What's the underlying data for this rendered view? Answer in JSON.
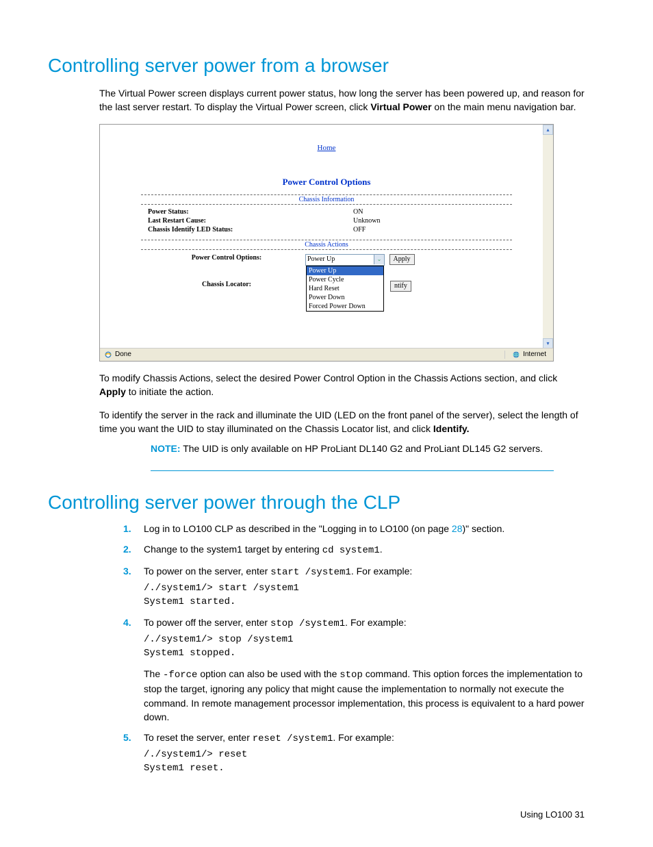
{
  "h1_browser": "Controlling server power from a browser",
  "intro_para_pre": "The Virtual Power screen displays current power status, how long the server has been powered up, and reason for the last server restart. To display the Virtual Power screen, click ",
  "intro_bold": "Virtual Power",
  "intro_para_post": " on the main menu navigation bar.",
  "screenshot": {
    "home_link": "Home",
    "title": "Power Control Options",
    "info_header": "Chassis Information",
    "rows": [
      {
        "label": "Power Status:",
        "value": "ON"
      },
      {
        "label": "Last Restart Cause:",
        "value": "Unknown"
      },
      {
        "label": "Chassis Identify LED Status:",
        "value": "OFF"
      }
    ],
    "actions_header": "Chassis Actions",
    "pco_label": "Power Control Options:",
    "pco_selected": "Power Up",
    "pco_options": [
      "Power Up",
      "Power Cycle",
      "Hard Reset",
      "Power Down",
      "Forced Power Down"
    ],
    "apply_btn": "Apply",
    "locator_label": "Chassis Locator:",
    "locator_btn": "ntify",
    "status_done": "Done",
    "status_zone": "Internet"
  },
  "modify_para_pre": "To modify Chassis Actions, select the desired Power Control Option in the Chassis Actions section, and click ",
  "modify_bold": "Apply",
  "modify_para_post": " to initiate the action.",
  "identify_para_pre": "To identify the server in the rack and illuminate the UID (LED on the front panel of the server), select the length of time you want the UID to stay illuminated on the Chassis Locator list, and click ",
  "identify_bold": "Identify.",
  "note_label": "NOTE:",
  "note_text": "  The UID is only available on HP ProLiant DL140 G2 and ProLiant DL145 G2 servers.",
  "h1_clp": "Controlling server power through the CLP",
  "steps": {
    "s1_pre": "Log in to LO100 CLP as described in the \"Logging in to LO100 (on page ",
    "s1_link": "28",
    "s1_post": ")\" section.",
    "s2_pre": "Change to the system1 target by entering ",
    "s2_code": "cd system1",
    "s2_post": ".",
    "s3_pre": "To power on the server, enter ",
    "s3_code": "start /system1",
    "s3_post": ". For example:",
    "s3_block": "/./system1/> start /system1\nSystem1 started.",
    "s4_pre": "To power off the server, enter ",
    "s4_code": "stop /system1",
    "s4_post": ". For example:",
    "s4_block": "/./system1/> stop /system1\nSystem1 stopped.",
    "s4_para_a": "The ",
    "s4_para_code1": "-force",
    "s4_para_b": " option can also be used with the ",
    "s4_para_code2": "stop",
    "s4_para_c": " command. This option forces the implementation to stop the target, ignoring any policy that might cause the implementation to normally not execute the command. In remote management processor implementation, this process is equivalent to a hard power down.",
    "s5_pre": "To reset the server, enter ",
    "s5_code": "reset /system1",
    "s5_post": ". For example:",
    "s5_block": "/./system1/> reset\nSystem1 reset."
  },
  "footer_text": "Using LO100   31"
}
